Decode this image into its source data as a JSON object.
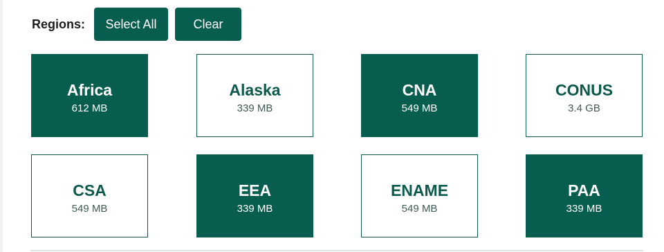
{
  "toolbar": {
    "label": "Regions:",
    "select_all_label": "Select All",
    "clear_label": "Clear"
  },
  "colors": {
    "accent": "#075e4e",
    "tile_border": "#0b5a4b",
    "background": "#ffffff"
  },
  "regions": [
    {
      "name": "Africa",
      "size": "612 MB",
      "selected": true
    },
    {
      "name": "Alaska",
      "size": "339 MB",
      "selected": false
    },
    {
      "name": "CNA",
      "size": "549 MB",
      "selected": true
    },
    {
      "name": "CONUS",
      "size": "3.4 GB",
      "selected": false
    },
    {
      "name": "CSA",
      "size": "549 MB",
      "selected": false
    },
    {
      "name": "EEA",
      "size": "339 MB",
      "selected": true
    },
    {
      "name": "ENAME",
      "size": "549 MB",
      "selected": false
    },
    {
      "name": "PAA",
      "size": "339 MB",
      "selected": true
    }
  ]
}
